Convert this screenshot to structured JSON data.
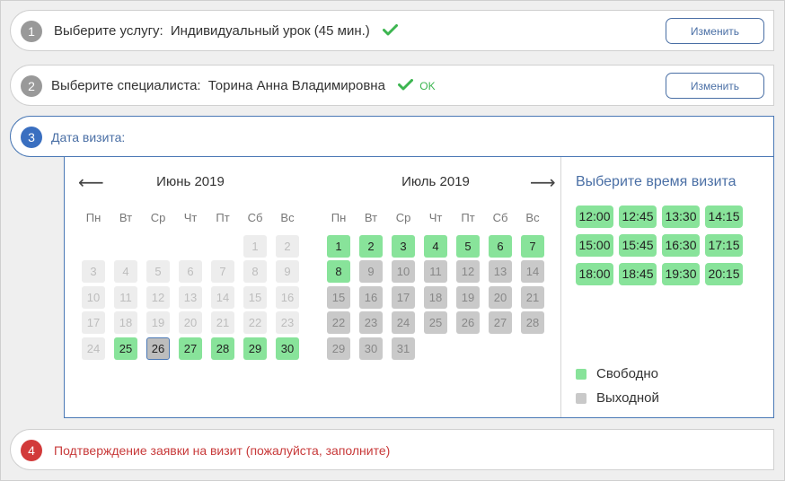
{
  "steps": {
    "service": {
      "number": "1",
      "label": "Выберите услугу:",
      "value": "Индивидуальный урок (45 мин.)",
      "change_label": "Изменить"
    },
    "specialist": {
      "number": "2",
      "label": "Выберите специалиста:",
      "value": "Торина Анна Владимировна",
      "ok_label": "OK",
      "change_label": "Изменить"
    },
    "date": {
      "number": "3",
      "label": "Дата визита:"
    },
    "confirm": {
      "number": "4",
      "label": "Подтверждение заявки на визит (пожалуйста, заполните)"
    }
  },
  "calendar": {
    "prev_arrow": "⟵",
    "next_arrow": "⟶",
    "weekdays": [
      "Пн",
      "Вт",
      "Ср",
      "Чт",
      "Пт",
      "Сб",
      "Вс"
    ],
    "months": [
      {
        "title": "Июнь 2019",
        "days": [
          {
            "d": "",
            "s": "blank"
          },
          {
            "d": "",
            "s": "blank"
          },
          {
            "d": "",
            "s": "blank"
          },
          {
            "d": "",
            "s": "blank"
          },
          {
            "d": "",
            "s": "blank"
          },
          {
            "d": "1",
            "s": "past"
          },
          {
            "d": "2",
            "s": "past"
          },
          {
            "d": "3",
            "s": "past"
          },
          {
            "d": "4",
            "s": "past"
          },
          {
            "d": "5",
            "s": "past"
          },
          {
            "d": "6",
            "s": "past"
          },
          {
            "d": "7",
            "s": "past"
          },
          {
            "d": "8",
            "s": "past"
          },
          {
            "d": "9",
            "s": "past"
          },
          {
            "d": "10",
            "s": "past"
          },
          {
            "d": "11",
            "s": "past"
          },
          {
            "d": "12",
            "s": "past"
          },
          {
            "d": "13",
            "s": "past"
          },
          {
            "d": "14",
            "s": "past"
          },
          {
            "d": "15",
            "s": "past"
          },
          {
            "d": "16",
            "s": "past"
          },
          {
            "d": "17",
            "s": "past"
          },
          {
            "d": "18",
            "s": "past"
          },
          {
            "d": "19",
            "s": "past"
          },
          {
            "d": "20",
            "s": "past"
          },
          {
            "d": "21",
            "s": "past"
          },
          {
            "d": "22",
            "s": "past"
          },
          {
            "d": "23",
            "s": "past"
          },
          {
            "d": "24",
            "s": "past"
          },
          {
            "d": "25",
            "s": "free"
          },
          {
            "d": "26",
            "s": "selected"
          },
          {
            "d": "27",
            "s": "free"
          },
          {
            "d": "28",
            "s": "free"
          },
          {
            "d": "29",
            "s": "free"
          },
          {
            "d": "30",
            "s": "free"
          }
        ]
      },
      {
        "title": "Июль 2019",
        "days": [
          {
            "d": "1",
            "s": "free"
          },
          {
            "d": "2",
            "s": "free"
          },
          {
            "d": "3",
            "s": "free"
          },
          {
            "d": "4",
            "s": "free"
          },
          {
            "d": "5",
            "s": "free"
          },
          {
            "d": "6",
            "s": "free"
          },
          {
            "d": "7",
            "s": "free"
          },
          {
            "d": "8",
            "s": "free"
          },
          {
            "d": "9",
            "s": "off"
          },
          {
            "d": "10",
            "s": "off"
          },
          {
            "d": "11",
            "s": "off"
          },
          {
            "d": "12",
            "s": "off"
          },
          {
            "d": "13",
            "s": "off"
          },
          {
            "d": "14",
            "s": "off"
          },
          {
            "d": "15",
            "s": "off"
          },
          {
            "d": "16",
            "s": "off"
          },
          {
            "d": "17",
            "s": "off"
          },
          {
            "d": "18",
            "s": "off"
          },
          {
            "d": "19",
            "s": "off"
          },
          {
            "d": "20",
            "s": "off"
          },
          {
            "d": "21",
            "s": "off"
          },
          {
            "d": "22",
            "s": "off"
          },
          {
            "d": "23",
            "s": "off"
          },
          {
            "d": "24",
            "s": "off"
          },
          {
            "d": "25",
            "s": "off"
          },
          {
            "d": "26",
            "s": "off"
          },
          {
            "d": "27",
            "s": "off"
          },
          {
            "d": "28",
            "s": "off"
          },
          {
            "d": "29",
            "s": "off"
          },
          {
            "d": "30",
            "s": "off"
          },
          {
            "d": "31",
            "s": "off"
          }
        ]
      }
    ]
  },
  "times": {
    "title": "Выберите время визита",
    "slots": [
      "12:00",
      "12:45",
      "13:30",
      "14:15",
      "15:00",
      "15:45",
      "16:30",
      "17:15",
      "18:00",
      "18:45",
      "19:30",
      "20:15"
    ]
  },
  "legend": [
    {
      "label": "Свободно",
      "color": "#88e39a"
    },
    {
      "label": "Выходной",
      "color": "#c9c9c9"
    }
  ],
  "colors": {
    "accent": "#4a6fa5",
    "free": "#88e39a",
    "day_off": "#c9c9c9",
    "check": "#3cb550",
    "confirm": "#c83a3a"
  }
}
